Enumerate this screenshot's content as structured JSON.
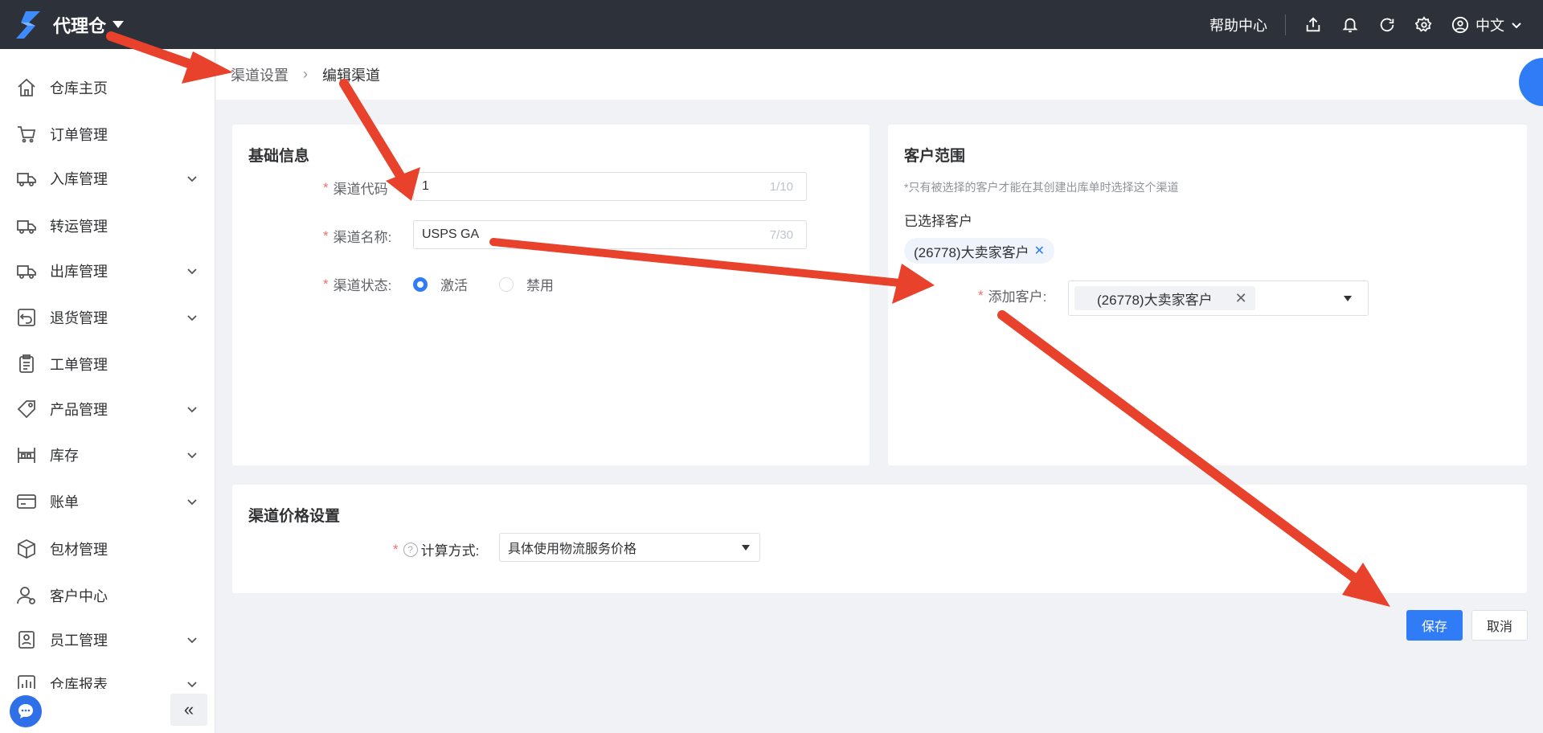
{
  "app": {
    "brand_name": "代理仓",
    "help_label": "帮助中心",
    "language": "中文"
  },
  "sidebar": {
    "items": [
      {
        "label": "仓库主页",
        "icon": "home-icon",
        "expandable": false
      },
      {
        "label": "订单管理",
        "icon": "cart-icon",
        "expandable": false
      },
      {
        "label": "入库管理",
        "icon": "inbound-truck-icon",
        "expandable": true
      },
      {
        "label": "转运管理",
        "icon": "transfer-truck-icon",
        "expandable": false
      },
      {
        "label": "出库管理",
        "icon": "outbound-truck-icon",
        "expandable": true
      },
      {
        "label": "退货管理",
        "icon": "return-icon",
        "expandable": true
      },
      {
        "label": "工单管理",
        "icon": "clipboard-icon",
        "expandable": false
      },
      {
        "label": "产品管理",
        "icon": "tag-icon",
        "expandable": true
      },
      {
        "label": "库存",
        "icon": "inventory-icon",
        "expandable": true
      },
      {
        "label": "账单",
        "icon": "bill-icon",
        "expandable": true
      },
      {
        "label": "包材管理",
        "icon": "package-icon",
        "expandable": false
      },
      {
        "label": "客户中心",
        "icon": "customer-icon",
        "expandable": false
      },
      {
        "label": "员工管理",
        "icon": "staff-icon",
        "expandable": true
      },
      {
        "label": "仓库报表",
        "icon": "report-icon",
        "expandable": true
      }
    ],
    "collapse_label": "«"
  },
  "breadcrumb": {
    "parent": "渠道设置",
    "separator": "›",
    "current": "编辑渠道"
  },
  "basic_info": {
    "title": "基础信息",
    "channel_code": {
      "label": "渠道代码",
      "value": "1",
      "counter": "1/10"
    },
    "channel_name": {
      "label": "渠道名称:",
      "value": "USPS GA",
      "counter": "7/30"
    },
    "channel_status": {
      "label": "渠道状态:",
      "options": [
        {
          "label": "激活",
          "selected": true
        },
        {
          "label": "禁用",
          "selected": false
        }
      ]
    }
  },
  "customer_scope": {
    "title": "客户范围",
    "hint": "*只有被选择的客户才能在其创建出库单时选择这个渠道",
    "selected_title": "已选择客户",
    "selected_tags": [
      "(26778)大卖家客户"
    ],
    "add_customer": {
      "label": "添加客户:",
      "selected": "(26778)大卖家客户"
    }
  },
  "price_settings": {
    "title": "渠道价格设置",
    "calc_method": {
      "label": "计算方式:",
      "value": "具体使用物流服务价格"
    }
  },
  "actions": {
    "save_label": "保存",
    "cancel_label": "取消"
  },
  "colors": {
    "primary": "#2f7cf6",
    "topbar": "#2d3139",
    "required": "#f56c6c",
    "annotation_arrow": "#e8412c"
  }
}
